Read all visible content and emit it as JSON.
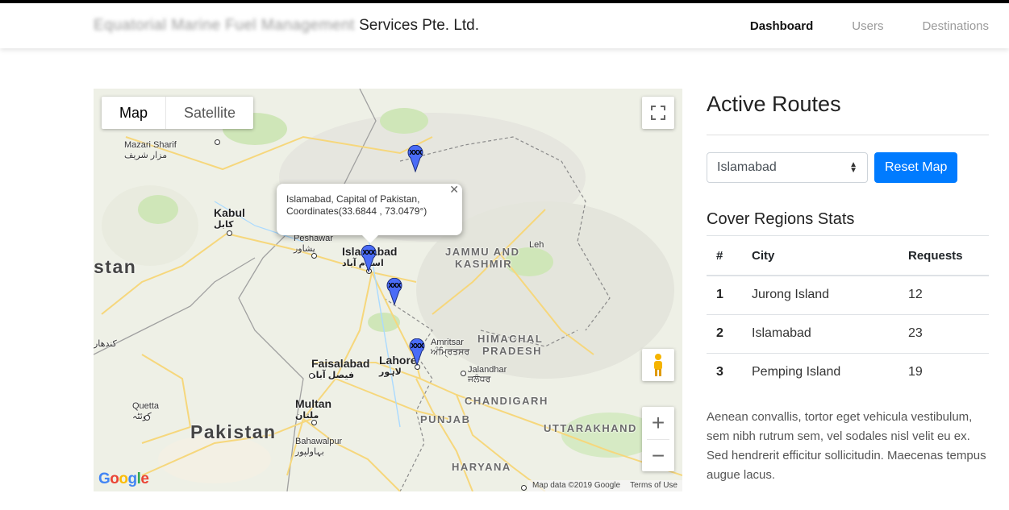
{
  "brand": {
    "blurred": "Equatorial Marine Fuel Management",
    "suffix": "Services Pte. Ltd."
  },
  "nav": {
    "items": [
      {
        "label": "Dashboard",
        "active": true
      },
      {
        "label": "Users",
        "active": false
      },
      {
        "label": "Destinations",
        "active": false
      }
    ]
  },
  "map": {
    "type_buttons": [
      "Map",
      "Satellite"
    ],
    "selected_type": "Map",
    "infowindow": {
      "line1": "Islamabad, Capital of Pakistan,",
      "line2": "Coordinates(33.6844 , 73.0479°)"
    },
    "marker_label": "xxx",
    "labels": {
      "mazari": "Mazari Sharif",
      "mazari_ur": "مزار شریف",
      "kabul": "Kabul",
      "kabul_ur": "کابل",
      "peshawar": "Peshawar",
      "peshawar_ur": "پشاور",
      "islamabad": "Islamabad",
      "islamabad_ur": "اسلام آباد",
      "stan": "stan",
      "jk1": "JAMMU AND",
      "jk2": "KASHMIR",
      "leh": "Leh",
      "hp1": "HIMACHAL",
      "hp2": "PRADESH",
      "amritsar": "Amritsar",
      "amritsar_ur": "ਅੰਮ੍ਰਿਤਸਰ",
      "jalandhar": "Jalandhar",
      "jalandhar_ur": "ਜਲੰਧਰ",
      "faisalabad": "Faisalabad",
      "faisalabad_ur": "فیصل آباد",
      "lahore": "Lahore",
      "lahore_ur": "لاہور",
      "chandigarh": "CHANDIGARH",
      "multan": "Multan",
      "multan_ur": "ملتان",
      "punjab": "PUNJAB",
      "uttarakhand": "UTTARAKHAND",
      "quetta": "Quetta",
      "quetta_ur": "کوئٹہ",
      "pakistan": "Pakistan",
      "bahawalpur": "Bahawalpur",
      "bahawalpur_ur": "بہاولپور",
      "kandahar": "Kandahar",
      "kandahar_ur": "کندهار",
      "haryana": "HARYANA"
    },
    "footer": {
      "attribution": "Map data ©2019 Google",
      "terms": "Terms of Use"
    },
    "logo": "Google"
  },
  "panel": {
    "title": "Active Routes",
    "select_value": "Islamabad",
    "reset_label": "Reset Map",
    "stats_title": "Cover Regions Stats",
    "table": {
      "headers": [
        "#",
        "City",
        "Requests"
      ],
      "rows": [
        [
          "1",
          "Jurong Island",
          "12"
        ],
        [
          "2",
          "Islamabad",
          "23"
        ],
        [
          "3",
          "Pemping Island",
          "19"
        ]
      ]
    },
    "paragraph": "Aenean convallis, tortor eget vehicula vestibulum, sem nibh rutrum sem, vel sodales nisl velit eu ex. Sed hendrerit efficitur sollicitudin. Maecenas tempus augue lacus."
  },
  "colors": {
    "primary": "#007bff",
    "marker": "#4a6cf7",
    "road": "#f8d77a"
  }
}
